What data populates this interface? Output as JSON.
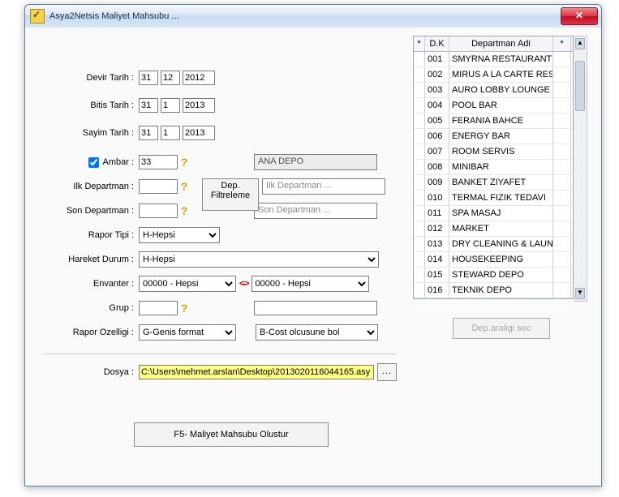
{
  "title": "Asya2Netsis Maliyet Mahsubu ...",
  "labels": {
    "devir_tarih": "Devir Tarih :",
    "bitis_tarih": "Bitis Tarih :",
    "sayim_tarih": "Sayim Tarih :",
    "ambar": "Ambar :",
    "ilk_dep": "Ilk Departman :",
    "son_dep": "Son Departman :",
    "rapor_tipi": "Rapor Tipi :",
    "hareket": "Hareket Durum :",
    "envanter": "Envanter :",
    "grup": "Grup :",
    "rapor_oz": "Rapor Ozelligi :",
    "dosya": "Dosya :"
  },
  "devir": {
    "d": "31",
    "m": "12",
    "y": "2012"
  },
  "bitis": {
    "d": "31",
    "m": "1",
    "y": "2013"
  },
  "sayim": {
    "d": "31",
    "m": "1",
    "y": "2013"
  },
  "ambar_val": "33",
  "ambar_name": "ANA DEPO",
  "ilk_dep_ph": "Ilk Departman ...",
  "son_dep_ph": "Son Departman ...",
  "dep_filtre_btn": "Dep. Filtreleme",
  "rapor_tipi_val": "H-Hepsi",
  "hareket_val": "H-Hepsi",
  "envanter1": "00000 - Hepsi",
  "envanter2": "00000 - Hepsi",
  "rapor_oz1": "G-Genis format",
  "rapor_oz2": "B-Cost olcusune bol",
  "dosya_val": "C:\\Users\\mehmet.arslan\\Desktop\\2013020116044165.asy",
  "browse": "...",
  "swap": "<->",
  "main_btn": "F5- Maliyet Mahsubu Olustur",
  "dep_btn": "Dep.araligi sec",
  "grid": {
    "h0": "*",
    "h1": "D.K",
    "h2": "Departman Adi",
    "h3": "*",
    "rows": [
      {
        "k": "001",
        "n": "SMYRNA RESTAURANT"
      },
      {
        "k": "002",
        "n": "MIRUS A LA CARTE RES"
      },
      {
        "k": "003",
        "n": "AURO LOBBY LOUNGE"
      },
      {
        "k": "004",
        "n": "POOL BAR"
      },
      {
        "k": "005",
        "n": "FERANIA BAHCE"
      },
      {
        "k": "006",
        "n": "ENERGY BAR"
      },
      {
        "k": "007",
        "n": "ROOM SERVIS"
      },
      {
        "k": "008",
        "n": "MINIBAR"
      },
      {
        "k": "009",
        "n": "BANKET ZIYAFET"
      },
      {
        "k": "010",
        "n": "TERMAL FIZIK TEDAVI"
      },
      {
        "k": "011",
        "n": "SPA MASAJ"
      },
      {
        "k": "012",
        "n": "MARKET"
      },
      {
        "k": "013",
        "n": "DRY CLEANING & LAUN"
      },
      {
        "k": "014",
        "n": "HOUSEKEEPING"
      },
      {
        "k": "015",
        "n": "STEWARD DEPO"
      },
      {
        "k": "016",
        "n": "TEKNIK DEPO"
      }
    ]
  }
}
